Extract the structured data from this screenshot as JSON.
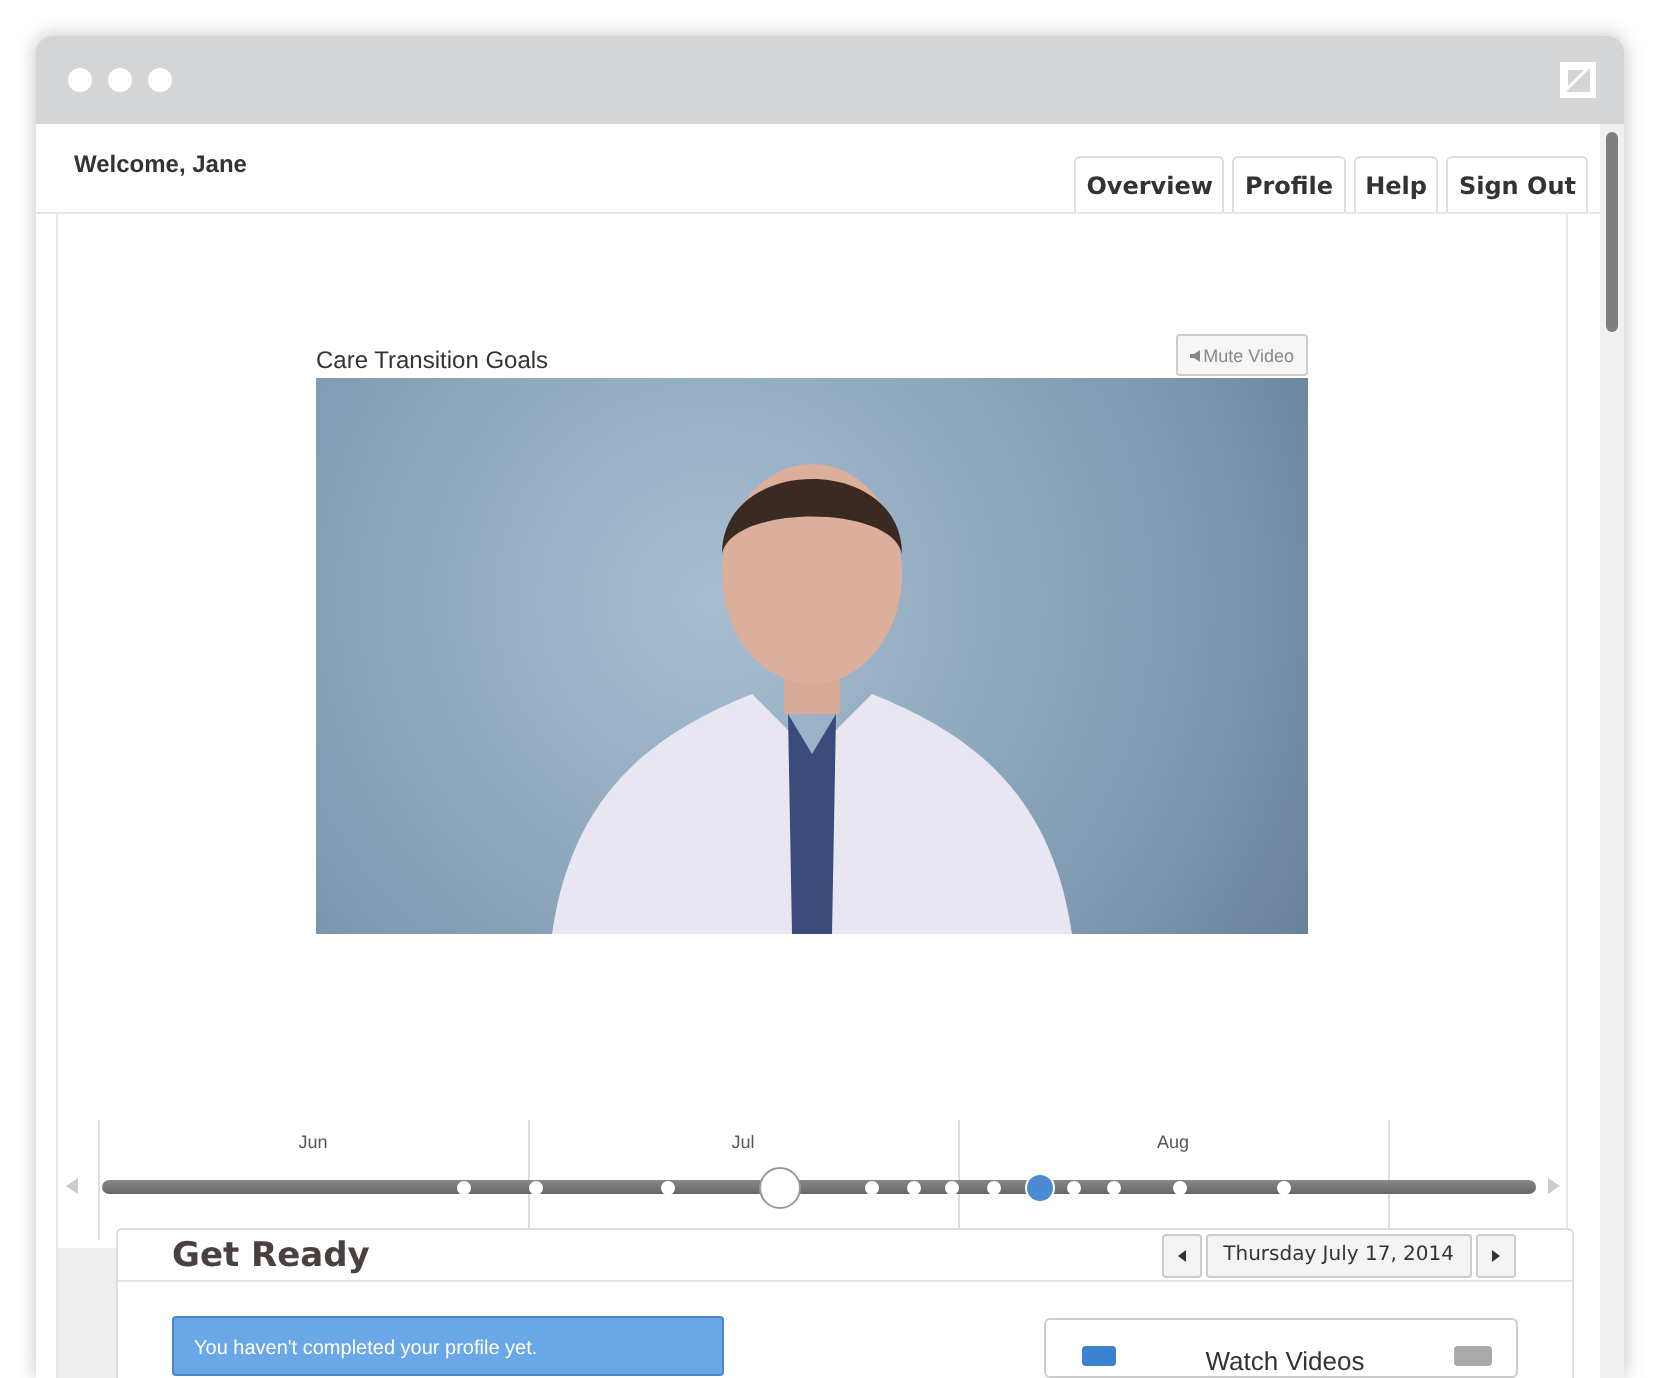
{
  "header": {
    "welcome": "Welcome, Jane",
    "tabs": [
      {
        "label": "Overview",
        "selected": false
      },
      {
        "label": "Profile",
        "selected": false
      },
      {
        "label": "Help",
        "selected": false
      },
      {
        "label": "Sign Out",
        "selected": false
      }
    ]
  },
  "video": {
    "title": "Care Transition Goals",
    "mute_button": "Mute Video"
  },
  "timeline": {
    "months": [
      "Jun",
      "Jul",
      "Aug"
    ],
    "points": [
      {
        "kind": "event"
      },
      {
        "kind": "event"
      },
      {
        "kind": "event"
      },
      {
        "kind": "selected"
      },
      {
        "kind": "event"
      },
      {
        "kind": "event"
      },
      {
        "kind": "event"
      },
      {
        "kind": "event"
      },
      {
        "kind": "today"
      },
      {
        "kind": "event"
      },
      {
        "kind": "event"
      },
      {
        "kind": "event"
      },
      {
        "kind": "event"
      }
    ]
  },
  "panel": {
    "title": "Get Ready",
    "date": "Thursday July 17, 2014",
    "alert": "You haven't completed your profile yet.",
    "card_title": "Watch Videos"
  }
}
